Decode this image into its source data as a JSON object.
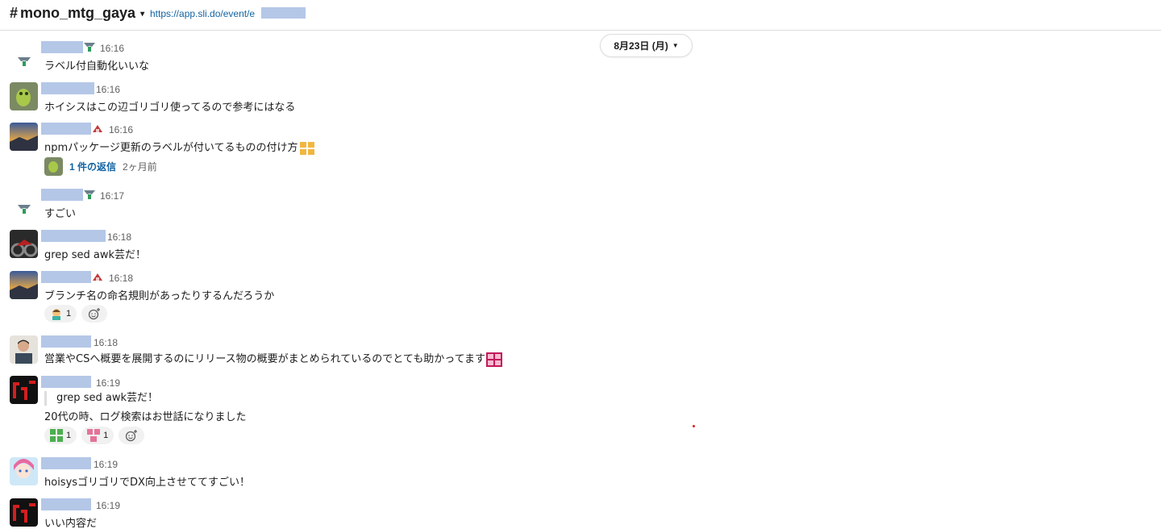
{
  "header": {
    "channel_hash": "#",
    "channel_name": "mono_mtg_gaya",
    "topic_link": "https://app.sli.do/event/e"
  },
  "date_divider": {
    "label": "8月23日 (月)"
  },
  "messages": [
    {
      "time": "16:16",
      "text": "ラベル付自動化いいな",
      "status_icon": "animal-status-icon"
    },
    {
      "time": "16:16",
      "text": "ホイシスはこの辺ゴリゴリ使ってるので参考にはなる"
    },
    {
      "time": "16:16",
      "text": "npmパッケージ更新のラベルが付いてるものの付け方",
      "status_icon": "red-status-icon",
      "inline_emoji": "気になる"
    },
    {
      "time": "16:17",
      "text": "すごい",
      "status_icon": "animal-status-icon"
    },
    {
      "time": "16:18",
      "text": "grep sed awk芸だ！"
    },
    {
      "time": "16:18",
      "text": "ブランチ名の命名規則があったりするんだろうか",
      "status_icon": "red-status-icon"
    },
    {
      "time": "16:18",
      "text": "営業やCSへ概要を展開するのにリリース物の概要がまとめられているのでとても助かってます",
      "inline_emoji": "感謝"
    },
    {
      "time": "16:19",
      "quote": "grep sed awk芸だ！",
      "text": "20代の時、ログ検索はお世話になりました"
    },
    {
      "time": "16:19",
      "text": "hoisysゴリゴリでDX向上させててすごい！"
    },
    {
      "time": "16:19",
      "text": "いい内容だ"
    }
  ],
  "thread": {
    "replies": "1 件の返信",
    "ago": "2ヶ月前"
  },
  "reactions": {
    "msg6": [
      {
        "emoji": "person-emoji",
        "count": "1"
      }
    ],
    "msg8": [
      {
        "emoji": "green-text-emoji",
        "count": "1"
      },
      {
        "emoji": "pink-text-emoji",
        "count": "1"
      }
    ]
  },
  "colors": {
    "link": "#1264a3",
    "redaction": "#b4c7e7",
    "timestamp": "#616061"
  }
}
